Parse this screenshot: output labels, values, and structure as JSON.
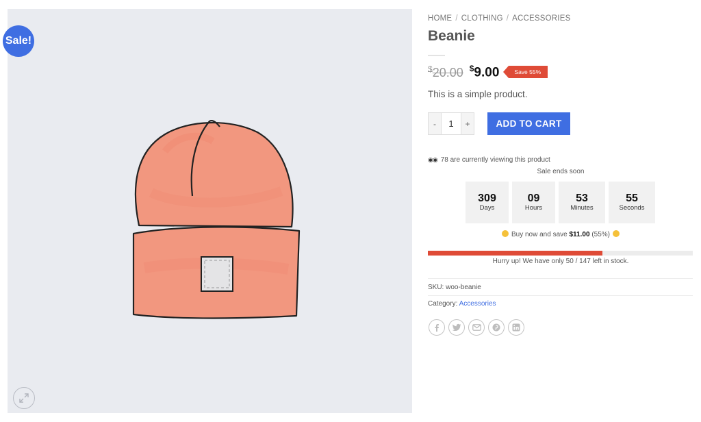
{
  "badge": {
    "sale": "Sale!"
  },
  "breadcrumb": {
    "home": "HOME",
    "clothing": "CLOTHING",
    "accessories": "ACCESSORIES",
    "separator": "/"
  },
  "product": {
    "title": "Beanie",
    "old_price_symbol": "$",
    "old_price": "20.00",
    "new_price_symbol": "$",
    "new_price": "9.00",
    "save_tag": "Save 55%",
    "short_description": "This is a simple product."
  },
  "cart": {
    "quantity": "1",
    "minus": "-",
    "plus": "+",
    "add_to_cart": "ADD TO CART"
  },
  "urgency": {
    "viewing": "78 are currently viewing this product",
    "sale_ends": "Sale ends soon",
    "countdown": [
      {
        "value": "309",
        "label": "Days"
      },
      {
        "value": "09",
        "label": "Hours"
      },
      {
        "value": "53",
        "label": "Minutes"
      },
      {
        "value": "55",
        "label": "Seconds"
      }
    ],
    "buy_now_prefix": "Buy now and save",
    "buy_now_amount": "$11.00",
    "buy_now_percent": "(55%)",
    "stock_text": "Hurry up! We have only 50 / 147 left in stock.",
    "stock_remaining": 50,
    "stock_total": 147,
    "stock_fill_fraction": 0.66
  },
  "meta": {
    "sku_label": "SKU:",
    "sku_value": "woo-beanie",
    "category_label": "Category:",
    "category_value": "Accessories"
  },
  "social": [
    "facebook-icon",
    "twitter-icon",
    "email-icon",
    "pinterest-icon",
    "linkedin-icon"
  ],
  "colors": {
    "accent": "#3f6ee2",
    "sale_red": "#df4b37",
    "gallery_bg": "#e9ebf0",
    "beanie": "#f2977f"
  }
}
